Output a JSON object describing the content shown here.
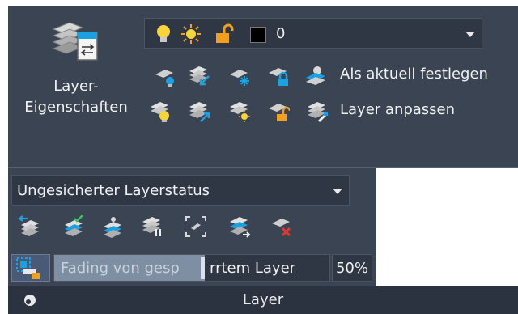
{
  "panel": {
    "big_button": {
      "line1": "Layer-",
      "line2": "Eigenschaften",
      "icon": "layer-properties-icon"
    },
    "layer_dropdown": {
      "value": "0",
      "icons": [
        "light-bulb-on-icon",
        "sun-thaw-icon",
        "padlock-unlocked-icon",
        "color-swatch-icon"
      ],
      "swatch_color": "#000000"
    },
    "row1": {
      "icons": [
        "layer-off-icon",
        "layer-isolate-icon",
        "layer-freeze-icon",
        "layer-lock-icon",
        "make-current-icon"
      ],
      "label": "Als aktuell festlegen"
    },
    "row2": {
      "icons": [
        "layer-on-icon",
        "layer-unisolate-icon",
        "layer-thaw-icon",
        "layer-unlock-icon",
        "match-layer-icon"
      ],
      "label": "Layer anpassen"
    },
    "status_dropdown": {
      "value": "Ungesicherter Layerstatus"
    },
    "row3": {
      "icons": [
        "layer-previous-icon",
        "layer-states-icon",
        "layer-walk-icon",
        "merge-layer-icon",
        "select-layer-icon",
        "copy-to-layer-icon",
        "delete-layer-icon"
      ]
    },
    "fading": {
      "icon": "locked-layer-fading-icon",
      "text_highlighted": "Fading von gesp",
      "text_rest": "rrtem Layer",
      "percent": "50%",
      "fraction": 0.5
    },
    "footer": {
      "title": "Layer",
      "pin_icon": "pin-icon"
    }
  },
  "colors": {
    "panel_bg": "#3b4453",
    "footer_bg": "#2b3240",
    "accent_blue": "#1ba1e2",
    "bulb_yellow": "#f7d43a",
    "lock_orange": "#f0a020",
    "delete_red": "#e03a2f"
  }
}
